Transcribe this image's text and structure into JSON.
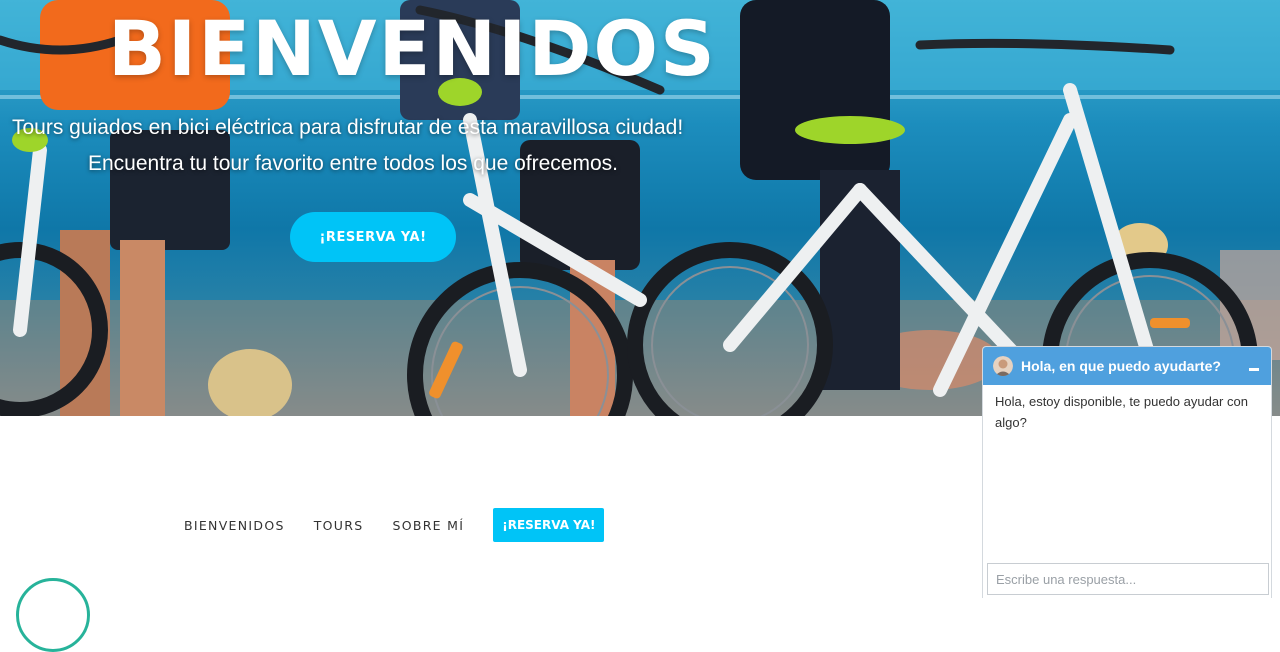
{
  "colors": {
    "accent": "#00c4f7",
    "chat_header": "#4fa0de",
    "logo_green": "#27b39a"
  },
  "hero": {
    "title": "BIENVENIDOS",
    "subtitle_line1": "Tours guiados en bici eléctrica para disfrutar de esta maravillosa ciudad!",
    "subtitle_line2": "Encuentra tu tour favorito entre todos los que ofrecemos.",
    "cta_label": "¡RESERVA YA!"
  },
  "nav": {
    "items": [
      {
        "label": "BIENVENIDOS"
      },
      {
        "label": "TOURS"
      },
      {
        "label": "SOBRE MÍ"
      }
    ],
    "cta_label": "¡RESERVA YA!"
  },
  "chat": {
    "header_title": "Hola, en que puedo ayudarte?",
    "message": "Hola, estoy disponible, te puedo ayudar con algo?",
    "input_placeholder": "Escribe una respuesta..."
  }
}
